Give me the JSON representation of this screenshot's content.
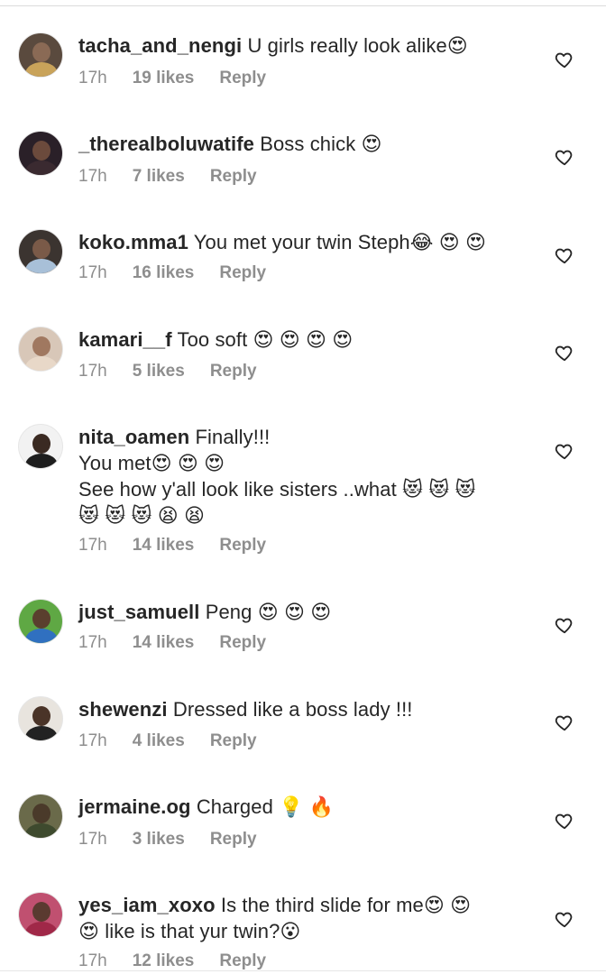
{
  "comments": [
    {
      "username": "tacha_and_nengi",
      "lines": [
        "U girls really look alike😍"
      ],
      "time": "17h",
      "likes": "19 likes",
      "reply": "Reply",
      "avatar_colors": {
        "bg": "#5a4a3e",
        "head": "#8a6a55",
        "body": "#c9a35a"
      }
    },
    {
      "username": "_therealboluwatife",
      "lines": [
        "Boss chick 😍"
      ],
      "time": "17h",
      "likes": "7 likes",
      "reply": "Reply",
      "avatar_colors": {
        "bg": "#2a2028",
        "head": "#6b4a3c",
        "body": "#3a2a30"
      }
    },
    {
      "username": "koko.mma1",
      "lines": [
        "You met your twin Steph😂 😍 😍"
      ],
      "time": "17h",
      "likes": "16 likes",
      "reply": "Reply",
      "avatar_colors": {
        "bg": "#3b3430",
        "head": "#7a5a48",
        "body": "#a8c0d8"
      }
    },
    {
      "username": "kamari__f",
      "lines": [
        "Too soft 😍 😍 😍 😍"
      ],
      "time": "17h",
      "likes": "5 likes",
      "reply": "Reply",
      "avatar_colors": {
        "bg": "#d8c7b8",
        "head": "#a07860",
        "body": "#e8d8c8"
      }
    },
    {
      "username": "nita_oamen",
      "lines": [
        "Finally!!!",
        "You met😍 😍 😍",
        "See how y'all look like sisters ..what 😻 😻 😻",
        "😻 😻 😻 😫 😫"
      ],
      "time": "17h",
      "likes": "14 likes",
      "reply": "Reply",
      "avatar_colors": {
        "bg": "#f2f2f2",
        "head": "#3a2a22",
        "body": "#1e1e1e"
      }
    },
    {
      "username": "just_samuell",
      "lines": [
        "Peng 😍 😍 😍"
      ],
      "time": "17h",
      "likes": "14 likes",
      "reply": "Reply",
      "avatar_colors": {
        "bg": "#5fa844",
        "head": "#5a3f2e",
        "body": "#3070c0"
      }
    },
    {
      "username": "shewenzi",
      "lines": [
        "Dressed like a boss lady !!!"
      ],
      "time": "17h",
      "likes": "4 likes",
      "reply": "Reply",
      "avatar_colors": {
        "bg": "#e8e4de",
        "head": "#4a3428",
        "body": "#222222"
      }
    },
    {
      "username": "jermaine.og",
      "lines": [
        "Charged 💡 🔥"
      ],
      "time": "17h",
      "likes": "3 likes",
      "reply": "Reply",
      "avatar_colors": {
        "bg": "#6a6a4a",
        "head": "#4a3a2a",
        "body": "#3e4a2e"
      }
    },
    {
      "username": "yes_iam_xoxo",
      "lines": [
        "Is the third slide for me😍 😍",
        "😍 like is that yur twin?😮"
      ],
      "time": "17h",
      "likes": "12 likes",
      "reply": "Reply",
      "avatar_colors": {
        "bg": "#c05070",
        "head": "#5a3a30",
        "body": "#a02848"
      }
    }
  ],
  "icons": {
    "like": "heart-outline-icon"
  },
  "colors": {
    "text": "#262626",
    "meta": "#8e8e8e",
    "divider": "#dbdbdb"
  }
}
